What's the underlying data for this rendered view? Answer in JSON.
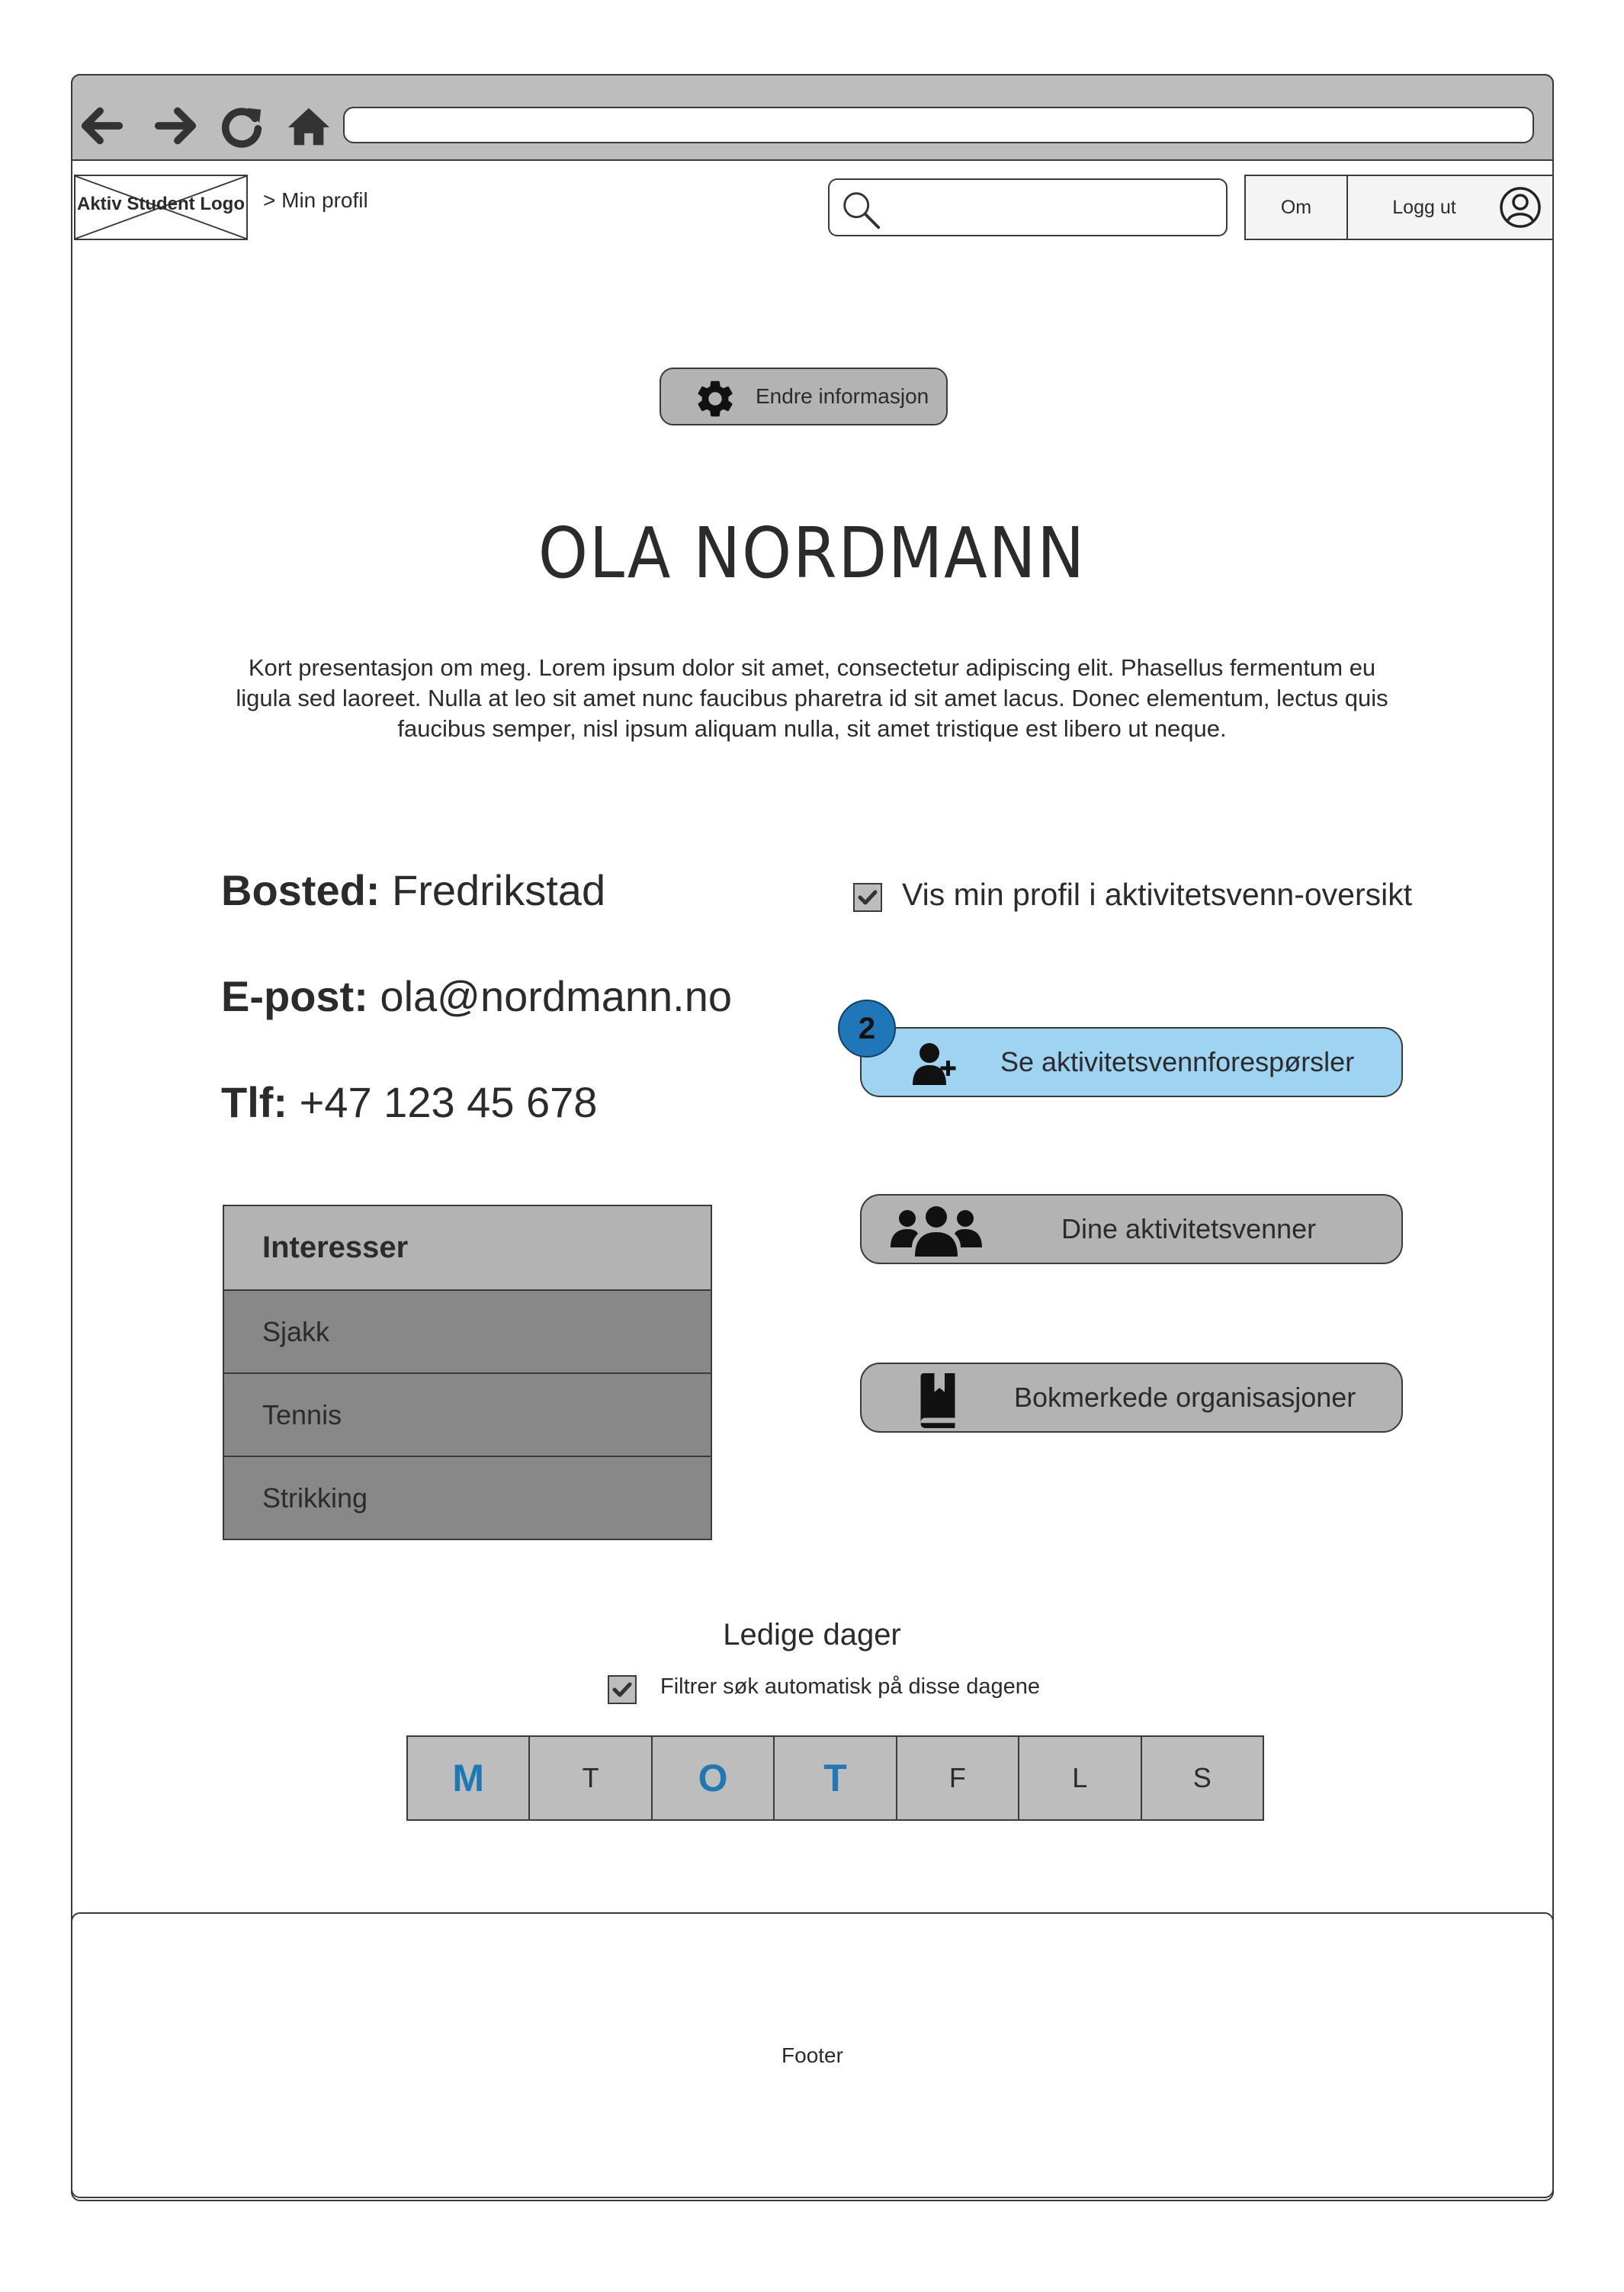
{
  "browser": {
    "back_icon": "arrow-left-icon",
    "forward_icon": "arrow-right-icon",
    "reload_icon": "reload-icon",
    "home_icon": "home-icon",
    "url": ""
  },
  "header": {
    "logo_text": "Aktiv Student Logo",
    "breadcrumb": "> Min profil",
    "search_placeholder": "",
    "nav_om": "Om",
    "nav_logout": "Logg ut"
  },
  "profile": {
    "edit_label": "Endre informasjon",
    "name": "OLA NORDMANN",
    "bio": "Kort presentasjon om meg. Lorem ipsum dolor sit amet, consectetur adipiscing elit. Phasellus fermentum eu ligula sed laoreet. Nulla at leo sit amet nunc faucibus pharetra id sit amet lacus. Donec elementum, lectus quis faucibus semper, nisl ipsum aliquam nulla, sit amet tristique est libero ut neque.",
    "bosted_label": "Bosted:",
    "bosted_value": "Fredrikstad",
    "epost_label": "E-post:",
    "epost_value": "ola@nordmann.no",
    "tlf_label": "Tlf:",
    "tlf_value": "+47 123 45 678"
  },
  "interests": {
    "title": "Interesser",
    "items": [
      "Sjakk",
      "Tennis",
      "Strikking"
    ]
  },
  "actions": {
    "show_profile_label": "Vis min profil i aktivitetsvenn-oversikt",
    "show_profile_checked": true,
    "requests_label": "Se aktivitetsvennforespørsler",
    "requests_badge": "2",
    "friends_label": "Dine aktivitetsvenner",
    "bookmarks_label": "Bokmerkede organisasjoner"
  },
  "days": {
    "title": "Ledige dager",
    "filter_label": "Filtrer søk automatisk på disse dagene",
    "filter_checked": true,
    "items": [
      {
        "label": "M",
        "selected": true
      },
      {
        "label": "T",
        "selected": false
      },
      {
        "label": "O",
        "selected": true
      },
      {
        "label": "T",
        "selected": true
      },
      {
        "label": "F",
        "selected": false
      },
      {
        "label": "L",
        "selected": false
      },
      {
        "label": "S",
        "selected": false
      }
    ]
  },
  "footer": {
    "label": "Footer"
  },
  "colors": {
    "chrome_gray": "#bdbdbd",
    "button_gray": "#b3b3b3",
    "list_gray": "#888888",
    "accent_blue": "#1f78b4",
    "request_button": "#9fd3f2"
  }
}
